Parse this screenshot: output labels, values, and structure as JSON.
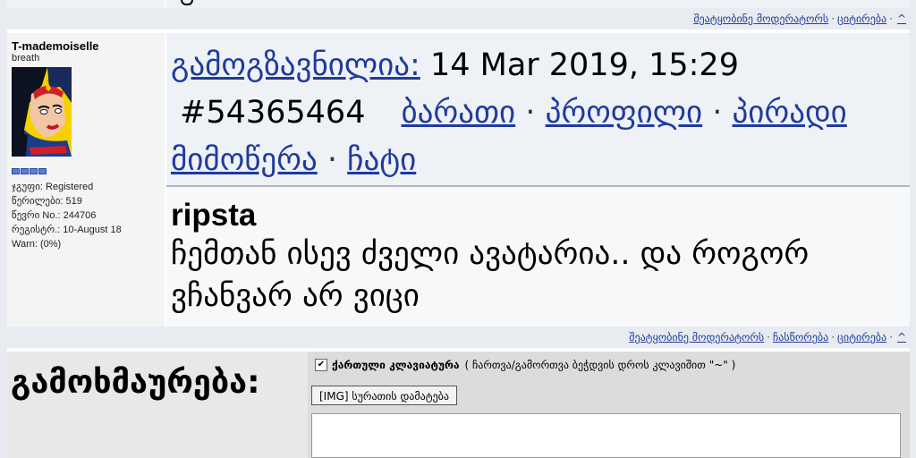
{
  "prev_post": {
    "links": [
      "შეატყობინე მოდერატორს",
      "ციტირება",
      "^"
    ]
  },
  "post": {
    "author": {
      "name": "T-mademoiselle",
      "title": "breath",
      "avatar_icon": "pop-art-wonder-woman-avatar",
      "rank_pips": 4,
      "stats": [
        "ჯგუფი: Registered",
        "წერილები: 519",
        "წევრი No.: 244706",
        "რეგისტრ.: 10-August 18",
        "Warn: (0%)"
      ]
    },
    "header": {
      "sent_label": "გამოგზავნილია:",
      "date": " 14 Mar 2019, 15:29",
      "post_number": "#54365464",
      "links": [
        "ბარათი",
        "პროფილი",
        "პირადი მიმოწერა",
        "ჩატი"
      ],
      "separator": "·"
    },
    "poster_name": "ripsta",
    "message": "ჩემთან ისევ ძველი ავატარია.. და როგორ ვჩანვარ არ ვიცი",
    "footer_links": [
      "შეატყობინე მოდერატორს",
      "ჩასწორება",
      "ციტირება",
      "^"
    ]
  },
  "reply_form": {
    "label": "გამოხმაურება:",
    "keyboard_checkbox_checked": true,
    "keyboard_label": "ქართული კლავიატურა",
    "keyboard_hint": "( ჩართვა/გამორთვა ბეჭდვის დროს კლავიშით \"~\" )",
    "img_button": "[IMG] სურათის დამატება"
  },
  "colors": {
    "link": "#1f3a9e",
    "header_bg": "#eef1f5",
    "linkrow_bg": "#e8ecf0",
    "avatar_bg": "#f7d000"
  }
}
